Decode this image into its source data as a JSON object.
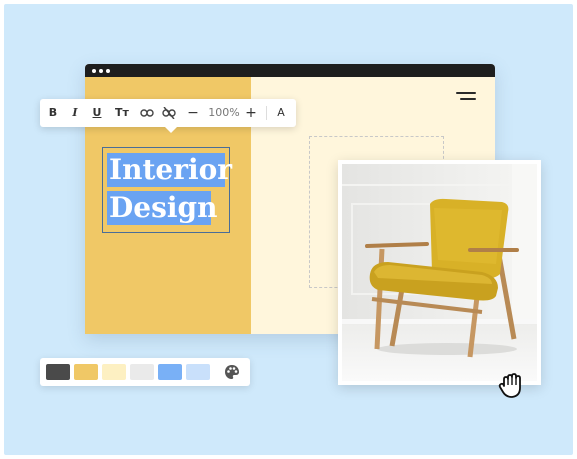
{
  "toolbar": {
    "bold_label": "B",
    "italic_label": "I",
    "underline_label": "U",
    "text_size_label": "Tт",
    "zoom_decrease_label": "−",
    "zoom_value": "100%",
    "zoom_increase_label": "+",
    "font_label": "A",
    "icons": [
      "link-icon",
      "unlink-icon"
    ]
  },
  "canvas": {
    "title_line_1": "Interior",
    "title_line_2": "Design"
  },
  "palette": {
    "swatches": [
      "#4a4a4a",
      "#f0c866",
      "#fdf0c2",
      "#eaeaea",
      "#79b0f6",
      "#c9e0fb"
    ],
    "icon": "palette-icon"
  },
  "colors": {
    "background": "#cfe9fb",
    "panel_yellow": "#f0c866",
    "page_cream": "#fff6dc",
    "selection_blue": "#6aa3f2",
    "titlebar": "#1e1e1e"
  },
  "cursor": "grab-hand-icon"
}
